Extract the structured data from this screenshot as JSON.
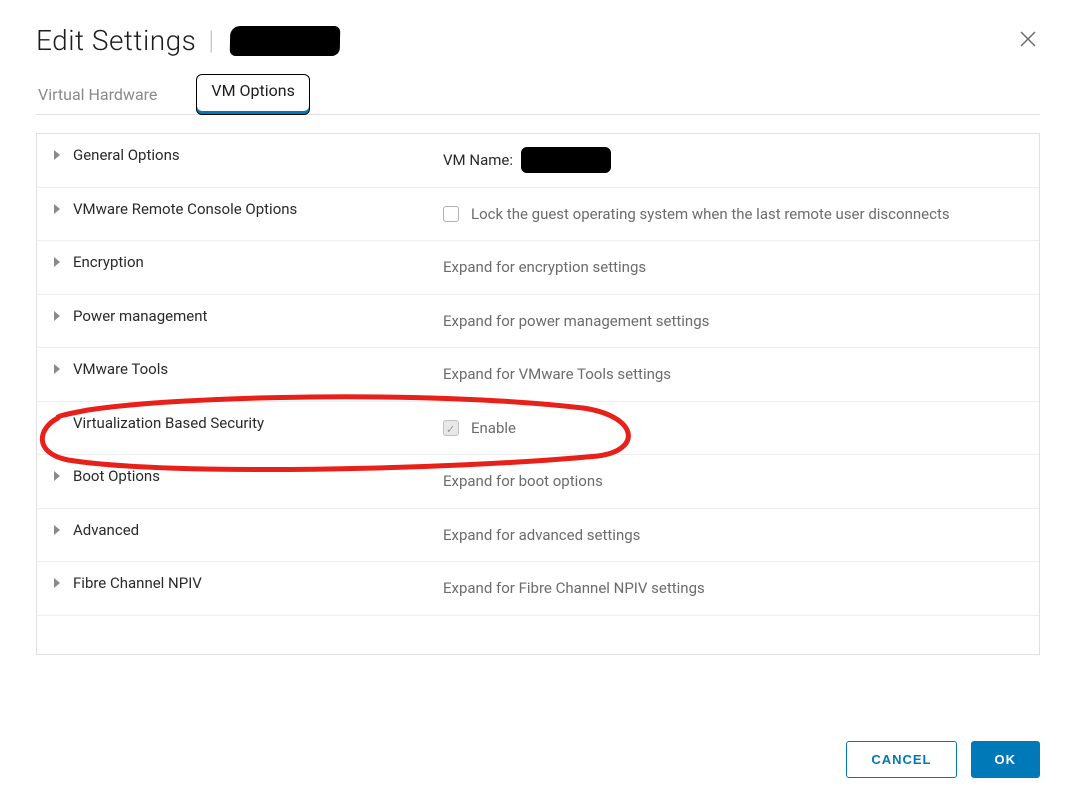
{
  "dialog": {
    "title": "Edit Settings"
  },
  "tabs": {
    "hardware": "Virtual Hardware",
    "options": "VM Options",
    "active": "options"
  },
  "rows": {
    "general": {
      "label": "General Options",
      "value_prefix": "VM Name:"
    },
    "remote_console": {
      "label": "VMware Remote Console Options",
      "checkbox_label": "Lock the guest operating system when the last remote user disconnects"
    },
    "encryption": {
      "label": "Encryption",
      "value": "Expand for encryption settings"
    },
    "power": {
      "label": "Power management",
      "value": "Expand for power management settings"
    },
    "vmtools": {
      "label": "VMware Tools",
      "value": "Expand for VMware Tools settings"
    },
    "vbs": {
      "label": "Virtualization Based Security",
      "checkbox_label": "Enable"
    },
    "boot": {
      "label": "Boot Options",
      "value": "Expand for boot options"
    },
    "advanced": {
      "label": "Advanced",
      "value": "Expand for advanced settings"
    },
    "npiv": {
      "label": "Fibre Channel NPIV",
      "value": "Expand for Fibre Channel NPIV settings"
    }
  },
  "footer": {
    "cancel": "CANCEL",
    "ok": "OK"
  }
}
